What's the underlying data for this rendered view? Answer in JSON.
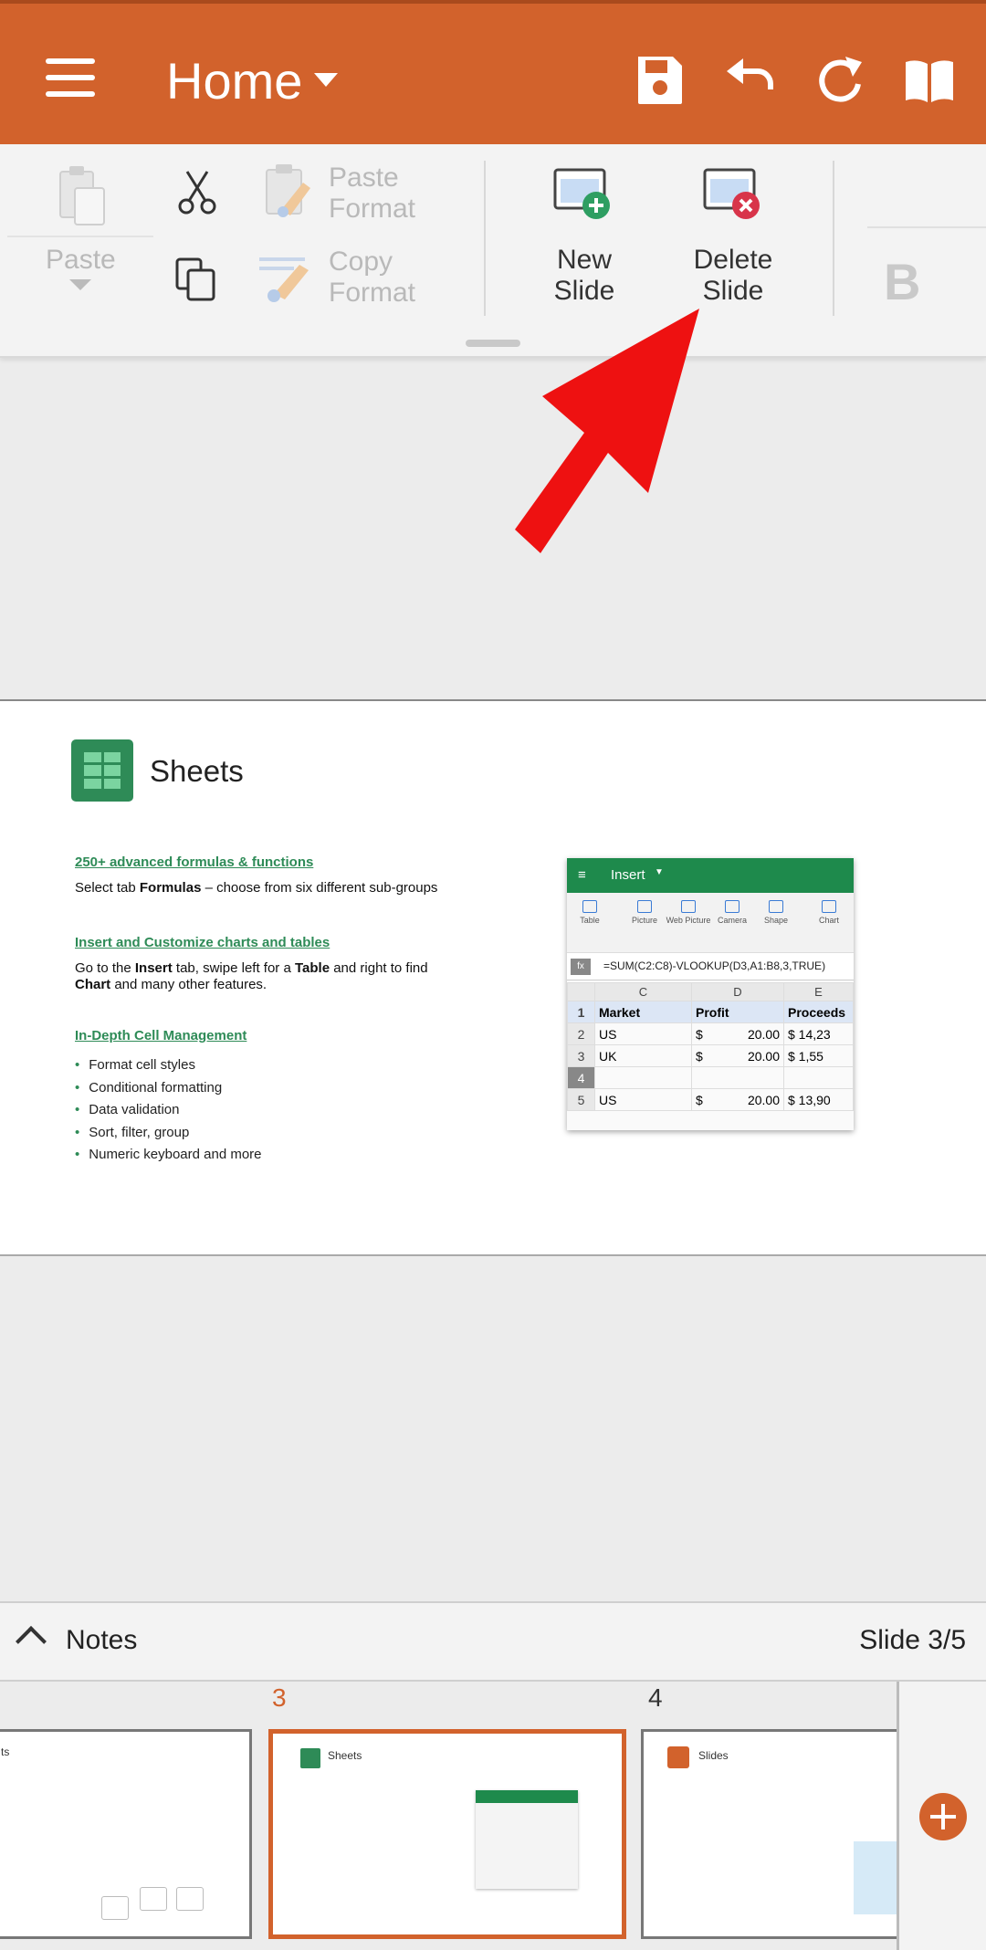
{
  "appbar": {
    "title": "Home",
    "icons": [
      "menu-icon",
      "save-icon",
      "undo-icon",
      "redo-icon",
      "book-icon"
    ],
    "color": "#d2622c"
  },
  "ribbon": {
    "paste": "Paste",
    "paste_format": [
      "Paste",
      "Format"
    ],
    "copy_format": [
      "Copy",
      "Format"
    ],
    "new_slide": [
      "New",
      "Slide"
    ],
    "delete_slide": [
      "Delete",
      "Slide"
    ],
    "bold": "B"
  },
  "slide": {
    "title": "Sheets",
    "sections": [
      {
        "heading": "250+ advanced formulas & functions"
      },
      {
        "heading": "Insert and Customize charts and tables"
      },
      {
        "heading": "In-Depth Cell Management"
      }
    ],
    "p1": {
      "a": "Select tab ",
      "b": "Formulas",
      "c": " – choose from six different sub-groups"
    },
    "p2": {
      "a": "Go to the ",
      "b": "Insert",
      "c": " tab, swipe left for a ",
      "d": "Table",
      "e": " and right to find",
      "f": "Chart",
      "g": " and many other features."
    },
    "bullets": [
      "Format cell styles",
      "Conditional formatting",
      "Data validation",
      "Sort, filter, group",
      "Numeric keyboard and more"
    ],
    "mini": {
      "tab": "Insert",
      "tools": [
        "Table",
        "Picture",
        "Web Picture",
        "Camera",
        "Shape",
        "Chart"
      ],
      "fx_label": "fx",
      "formula": "=SUM(C2:C8)-VLOOKUP(D3,A1:B8,3,TRUE)",
      "cols": [
        "C",
        "D",
        "E"
      ],
      "rows": [
        {
          "n": "1",
          "c": "Market",
          "d": "Profit",
          "d2": "",
          "e": "Proceeds"
        },
        {
          "n": "2",
          "c": "US",
          "d": "$",
          "d2": "20.00",
          "e": "$     14,23"
        },
        {
          "n": "3",
          "c": "UK",
          "d": "$",
          "d2": "20.00",
          "e": "$       1,55"
        },
        {
          "n": "4",
          "c": "",
          "d": "",
          "d2": "",
          "e": ""
        },
        {
          "n": "5",
          "c": "US",
          "d": "$",
          "d2": "20.00",
          "e": "$     13,90"
        }
      ]
    }
  },
  "notes": {
    "label": "Notes",
    "slide_counter": "Slide 3/5"
  },
  "thumbs": {
    "n3": "3",
    "n4": "4",
    "t3_title": "Sheets",
    "t4_title": "Slides",
    "t2_title": "ts"
  }
}
